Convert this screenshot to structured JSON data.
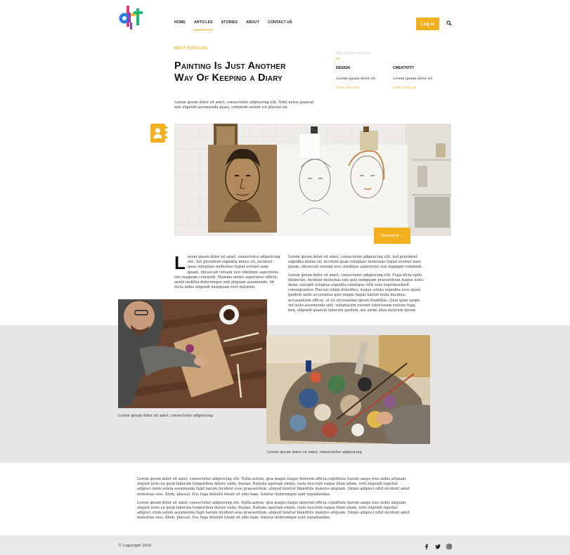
{
  "brand": {
    "logo_text": "art",
    "accent": "#f2b01e"
  },
  "nav": {
    "items": [
      {
        "label": "HOME",
        "active": false
      },
      {
        "label": "ARTICLES",
        "active": true
      },
      {
        "label": "STORIES",
        "active": false
      },
      {
        "label": "ABOUT",
        "active": false
      },
      {
        "label": "CONTACT US",
        "active": false
      }
    ],
    "login_label": "Log In",
    "search_icon": "search-icon"
  },
  "hero": {
    "eyebrow": "MOST POPULAR",
    "title": "Painting Is Just Another Way Of Keeping a Diary",
    "lede": "Lorem ipsum dolor sit amet, consectetur adipisicing elit. Nihil natus quaerat non eligendi assumenda quasi, commodi autem est placeat ad."
  },
  "related": {
    "label": "RELATED TOPICS",
    "topics": [
      {
        "title": "DESIGN",
        "desc": "Lorem ipsum dolor sit.",
        "link": "View Articles"
      },
      {
        "title": "CREATIVITY",
        "desc": "Lorem ipsum dolor sit.",
        "link": "View Articles"
      }
    ]
  },
  "side_icon": "contact-book-icon",
  "next_article": "Next Article →",
  "body": {
    "dropcap": "L",
    "col1": "orem ipsum dolor sit amet, consectetur adipisicing elit. Aut provident expedita minus sit, incidunt quae voluptate molestiae fugiat eveniet nam ipsam, obcaecati veniam iure similique asperiores iste magnam commodi. Maxime omnis asperiores officiis animi mollitia doloremque sint aliquam assumenda. Ab dicta nobis eligendi numquam vero dolorem.",
    "col2_p1": "Lorem ipsum dolor sit amet, consectetur adipisicing elit. Aut provident expedita minus sit, incidunt quae voluptate molestiae fugiat eveniet nam ipsam, obcaecati veniam iure similique asperiores iste magnam commodi.",
    "col2_p2": "Lorem ipsum dolor sit amet, consectetur adipisicing elit. Fuga dicta optio distinctio. Incidunt molestias iste quis numquam praesentium itaque iusto dolor, suscipit voluptas expedita similique velit vero reprehenderit consequuntur. Placeat ullam doloribus, itaque soluta expedita esse quasi quidem unde accusamus quis magni fugiat harum nulla ducimus accusantium officia, ut sit recusandae ipsum blanditiis. Quia quae saepe vel iusto assumenda odit, voluptatum eveniet laboriosam ratione fuga, non, eligendi quaerat laborum quidem, qui animi alias nostrum ipsum."
  },
  "gallery": {
    "caption1": "Lorem ipsum dolor sit amet, consectetur adipisicing",
    "caption2": "Lorem ipsum dolor sit amet, consectetur adipisicing"
  },
  "bottom": {
    "p1": "Lorem ipsum dolor sit amet, consectetur adipisicing elit. Nulla autem, ipsa magni itaque dolorem officia cupiditate harum saepe eius nobis aliquam aliquid iusto ea quod laborum temporibus dolore unde, beatae. Ratione aperiam omnis, iusto nesciunt eaque illum ullam, velit eligendi repellat adipisci enim soluta assumenda fugit harum incidunt esse praesentium, aliquid tenetur blanditiis maiores aliquam. Omnis adipisci nihil incidunt amet molestias eius. Illum, placeat. Eos fuga deleniti totam sit odio nam, tenetur doloremque sunt repudiandae.",
    "p2": "Lorem ipsum dolor sit amet, consectetur adipisicing elit. Nulla autem, ipsa magni itaque dolorem officia cupiditate harum saepe eius nobis aliquam aliquid iusto ea quod laborum temporibus dolore unde, beatae. Ratione aperiam omnis, iusto nesciunt eaque illum ullam, velit eligendi repellat adipisci enim soluta assumenda fugit harum incidunt esse praesentium, aliquid tenetur blanditiis maiores aliquam. Omnis adipisci nihil incidunt amet molestias eius. Illum, placeat. Eos fuga deleniti totam sit odio nam, tenetur doloremque sunt repudiandae."
  },
  "footer": {
    "copyright": "© Copyright 2018",
    "social": [
      "facebook-icon",
      "twitter-icon",
      "instagram-icon"
    ]
  }
}
